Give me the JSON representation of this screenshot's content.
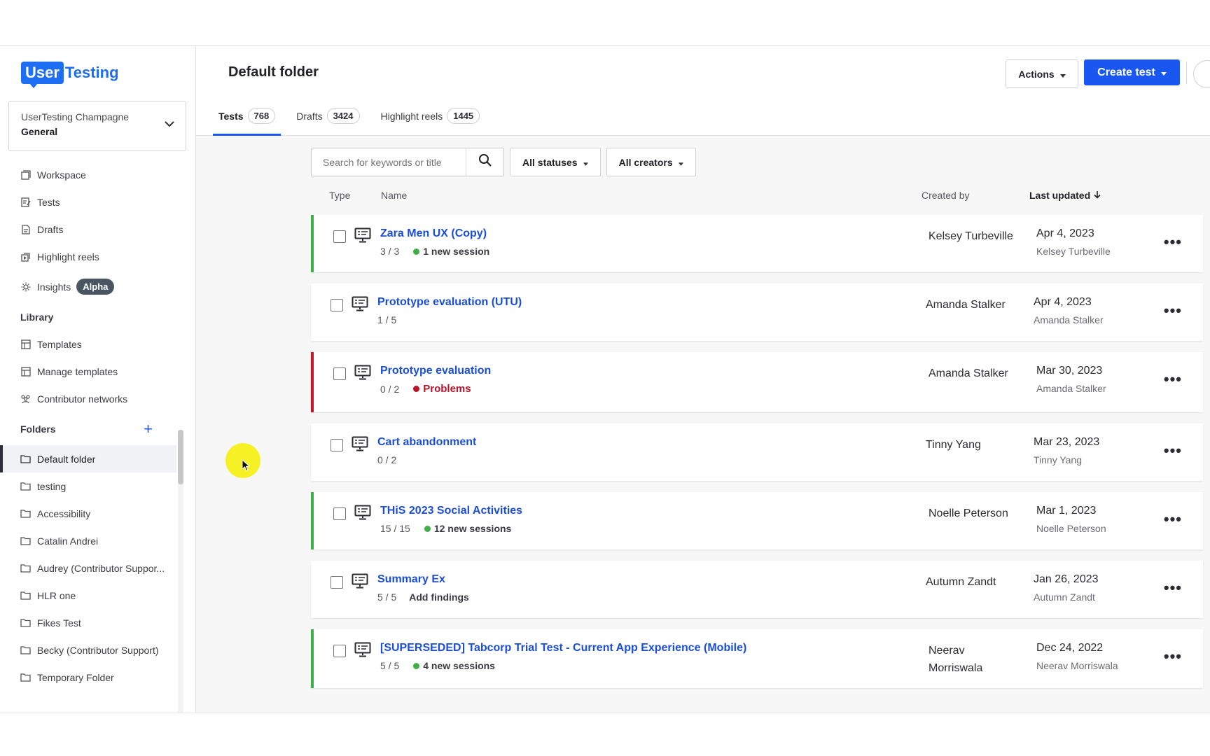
{
  "brand": {
    "logo_box": "User",
    "logo_text": "Testing",
    "accent": "#1a57f0"
  },
  "account": {
    "org": "UserTesting Champagne",
    "workspace": "General"
  },
  "nav": [
    {
      "label": "Workspace",
      "icon": "workspace-icon"
    },
    {
      "label": "Tests",
      "icon": "tests-icon"
    },
    {
      "label": "Drafts",
      "icon": "drafts-icon"
    },
    {
      "label": "Highlight reels",
      "icon": "highlight-reels-icon"
    },
    {
      "label": "Insights",
      "icon": "lightbulb-icon",
      "badge": "Alpha"
    }
  ],
  "library": {
    "label": "Library",
    "items": [
      {
        "label": "Templates",
        "icon": "templates-icon"
      },
      {
        "label": "Manage templates",
        "icon": "manage-templates-icon"
      },
      {
        "label": "Contributor networks",
        "icon": "contributor-networks-icon"
      }
    ]
  },
  "folders": {
    "label": "Folders",
    "items": [
      "Default folder",
      "testing",
      "Accessibility",
      "Catalin Andrei",
      "Audrey (Contributor Suppor...",
      "HLR one",
      "Fikes Test",
      "Becky (Contributor Support)",
      "Temporary Folder"
    ]
  },
  "header": {
    "title": "Default folder",
    "actions_label": "Actions",
    "create_label": "Create test"
  },
  "tabs": [
    {
      "label": "Tests",
      "count": "768"
    },
    {
      "label": "Drafts",
      "count": "3424"
    },
    {
      "label": "Highlight reels",
      "count": "1445"
    }
  ],
  "filters": {
    "search_placeholder": "Search for keywords or title",
    "status": "All statuses",
    "creators": "All creators"
  },
  "columns": {
    "type": "Type",
    "name": "Name",
    "created_by": "Created by",
    "last_updated": "Last updated"
  },
  "rows": [
    {
      "name": "Zara Men UX (Copy)",
      "progress": "3 / 3",
      "status": "1 new session",
      "status_kind": "new",
      "created_by": "Kelsey Turbeville",
      "date": "Apr 4, 2023",
      "updated_by": "Kelsey Turbeville",
      "border": "green"
    },
    {
      "name": "Prototype evaluation (UTU)",
      "progress": "1 / 5",
      "status": "",
      "status_kind": "none",
      "created_by": "Amanda Stalker",
      "date": "Apr 4, 2023",
      "updated_by": "Amanda Stalker",
      "border": "none"
    },
    {
      "name": "Prototype evaluation",
      "progress": "0 / 2",
      "status": "Problems",
      "status_kind": "problem",
      "created_by": "Amanda Stalker",
      "date": "Mar 30, 2023",
      "updated_by": "Amanda Stalker",
      "border": "red"
    },
    {
      "name": "Cart abandonment",
      "progress": "0 / 2",
      "status": "",
      "status_kind": "none",
      "created_by": "Tinny Yang",
      "date": "Mar 23, 2023",
      "updated_by": "Tinny Yang",
      "border": "none"
    },
    {
      "name": "THiS 2023 Social Activities",
      "progress": "15 / 15",
      "status": "12 new sessions",
      "status_kind": "new",
      "created_by": "Noelle Peterson",
      "date": "Mar 1, 2023",
      "updated_by": "Noelle Peterson",
      "border": "green"
    },
    {
      "name": "Summary Ex",
      "progress": "5 / 5",
      "status": "Add findings",
      "status_kind": "plain",
      "created_by": "Autumn Zandt",
      "date": "Jan 26, 2023",
      "updated_by": "Autumn Zandt",
      "border": "none"
    },
    {
      "name": "[SUPERSEDED] Tabcorp Trial Test - Current App Experience (Mobile)",
      "progress": "5 / 5",
      "status": "4 new sessions",
      "status_kind": "new",
      "created_by": "Neerav Morriswala",
      "date": "Dec 24, 2022",
      "updated_by": "Neerav Morriswala",
      "border": "green"
    }
  ]
}
